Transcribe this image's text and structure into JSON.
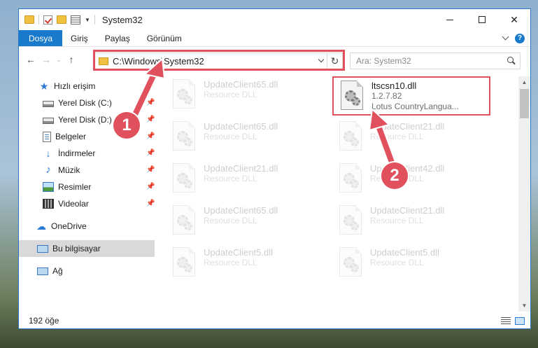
{
  "window": {
    "title": "System32"
  },
  "ribbon": {
    "tabs": [
      "Dosya",
      "Giriş",
      "Paylaş",
      "Görünüm"
    ],
    "help": "?"
  },
  "navigation": {
    "address": "C:\\Windows\\System32",
    "search_placeholder": "Ara: System32"
  },
  "sidebar": {
    "items": [
      {
        "label": "Hızlı erişim",
        "icon": "star-icon"
      },
      {
        "label": "Yerel Disk (C:)",
        "icon": "disk-icon",
        "pinned": true
      },
      {
        "label": "Yerel Disk (D:)",
        "icon": "disk-icon",
        "pinned": true
      },
      {
        "label": "Belgeler",
        "icon": "documents-icon",
        "pinned": true
      },
      {
        "label": "İndirmeler",
        "icon": "download-icon",
        "pinned": true
      },
      {
        "label": "Müzik",
        "icon": "music-icon",
        "pinned": true
      },
      {
        "label": "Resimler",
        "icon": "pictures-icon",
        "pinned": true
      },
      {
        "label": "Videolar",
        "icon": "videos-icon",
        "pinned": true
      },
      {
        "label": "OneDrive",
        "icon": "cloud-icon"
      },
      {
        "label": "Bu bilgisayar",
        "icon": "computer-icon",
        "selected": true
      },
      {
        "label": "Ağ",
        "icon": "network-icon"
      }
    ]
  },
  "files": [
    {
      "name": "UpdateClient65.dll",
      "type": "Resource DLL",
      "faded": true
    },
    {
      "name": "ltscsn10.dll",
      "version": "1.2.7.82",
      "desc": "Lotus CountryLangua...",
      "faded": false
    },
    {
      "name": "UpdateClient65.dll",
      "type": "Resource DLL",
      "faded": true
    },
    {
      "name": "UpdateClient21.dll",
      "type": "Resource DLL",
      "faded": true
    },
    {
      "name": "UpdateClient21.dll",
      "type": "Resource DLL",
      "faded": true
    },
    {
      "name": "UpdateClient42.dll",
      "type": "Resource DLL",
      "faded": true
    },
    {
      "name": "UpdateClient65.dll",
      "type": "Resource DLL",
      "faded": true
    },
    {
      "name": "UpdateClient21.dll",
      "type": "Resource DLL",
      "faded": true
    },
    {
      "name": "UpdateClient5.dll",
      "type": "Resource DLL",
      "faded": true
    },
    {
      "name": "UpdateClient5.dll",
      "type": "Resource DLL",
      "faded": true
    }
  ],
  "status": {
    "item_count": "192 öğe"
  },
  "annotations": {
    "step1": "1",
    "step2": "2",
    "color": "#e0505d"
  }
}
